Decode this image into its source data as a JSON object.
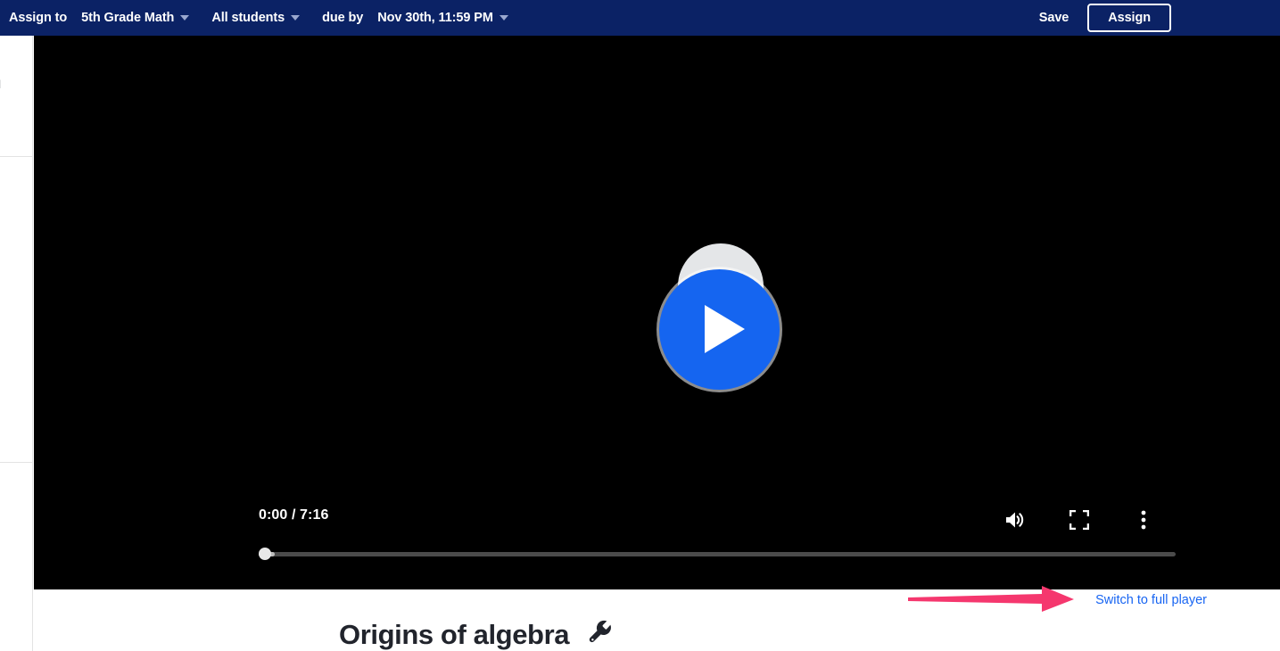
{
  "assign_bar": {
    "assign_to_label": "Assign to",
    "class_dropdown": {
      "value": "5th Grade Math",
      "icon": "chevron-down-icon"
    },
    "students_dropdown": {
      "value": "All students",
      "icon": "chevron-down-icon"
    },
    "due_by_label": "due by",
    "due_date_dropdown": {
      "value": "Nov 30th, 11:59 PM",
      "icon": "chevron-down-icon"
    },
    "save_label": "Save",
    "assign_label": "Assign",
    "background_color": "#0b2265"
  },
  "left_rail": {
    "clipped_text": "H"
  },
  "player": {
    "play_button_icon": "play-icon",
    "play_button_color": "#1565f0",
    "current_time": "0:00",
    "separator": "/",
    "duration": "7:16",
    "time_display": "0:00 / 7:16",
    "progress_percent": 0,
    "controls": [
      {
        "name": "volume-icon",
        "label": "Volume"
      },
      {
        "name": "fullscreen-icon",
        "label": "Fullscreen"
      },
      {
        "name": "more-options-icon",
        "label": "More options"
      }
    ]
  },
  "below_video": {
    "full_player_link": "Switch to full player",
    "link_color": "#1865f2",
    "annotation_arrow_color": "#f5376e"
  },
  "content": {
    "title": "Origins of algebra",
    "edit_icon": "wrench-icon"
  }
}
